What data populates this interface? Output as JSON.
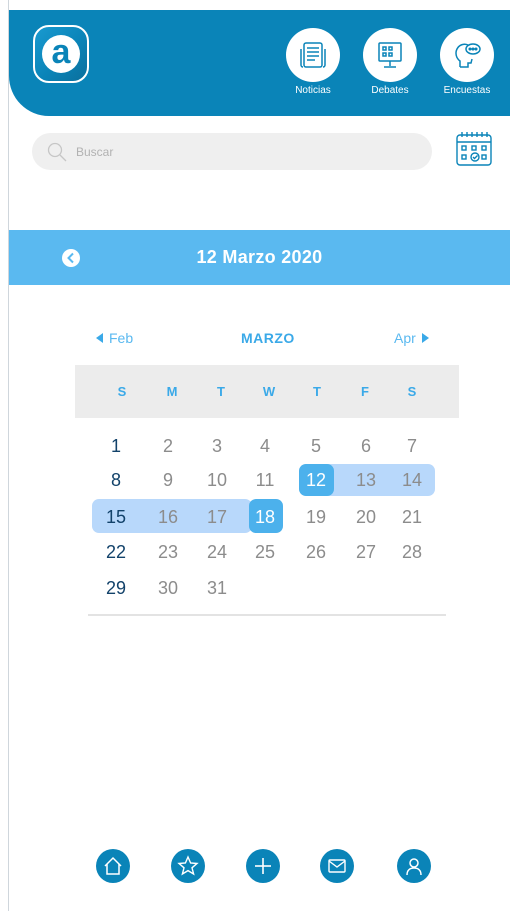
{
  "nav": {
    "items": [
      {
        "label": "Noticias",
        "icon": "newspaper-icon"
      },
      {
        "label": "Debates",
        "icon": "presentation-board-icon"
      },
      {
        "label": "Encuestas",
        "icon": "thinking-head-icon"
      }
    ]
  },
  "search": {
    "placeholder": "Buscar"
  },
  "banner": {
    "title": "12 Marzo 2020"
  },
  "calendar": {
    "prev_label": "Feb",
    "month_label": "MARZO",
    "next_label": "Apr",
    "weekdays": [
      "S",
      "M",
      "T",
      "W",
      "T",
      "F",
      "S"
    ],
    "weeks": [
      [
        "1",
        "2",
        "3",
        "4",
        "5",
        "6",
        "7"
      ],
      [
        "8",
        "9",
        "10",
        "11",
        "12",
        "13",
        "14"
      ],
      [
        "15",
        "16",
        "17",
        "18",
        "19",
        "20",
        "21"
      ],
      [
        "22",
        "23",
        "24",
        "25",
        "26",
        "27",
        "28"
      ],
      [
        "29",
        "30",
        "31",
        "",
        "",
        "",
        ""
      ]
    ],
    "selected_start": "12",
    "selected_end": "18"
  },
  "bottom_nav": [
    "home-icon",
    "star-icon",
    "plus-icon",
    "mail-icon",
    "profile-icon"
  ],
  "colors": {
    "primary": "#0a84b8",
    "banner": "#5ab9f0",
    "range": "#b8d8fb",
    "selected": "#4cb1ec",
    "weekday": "#3aa9e8"
  }
}
